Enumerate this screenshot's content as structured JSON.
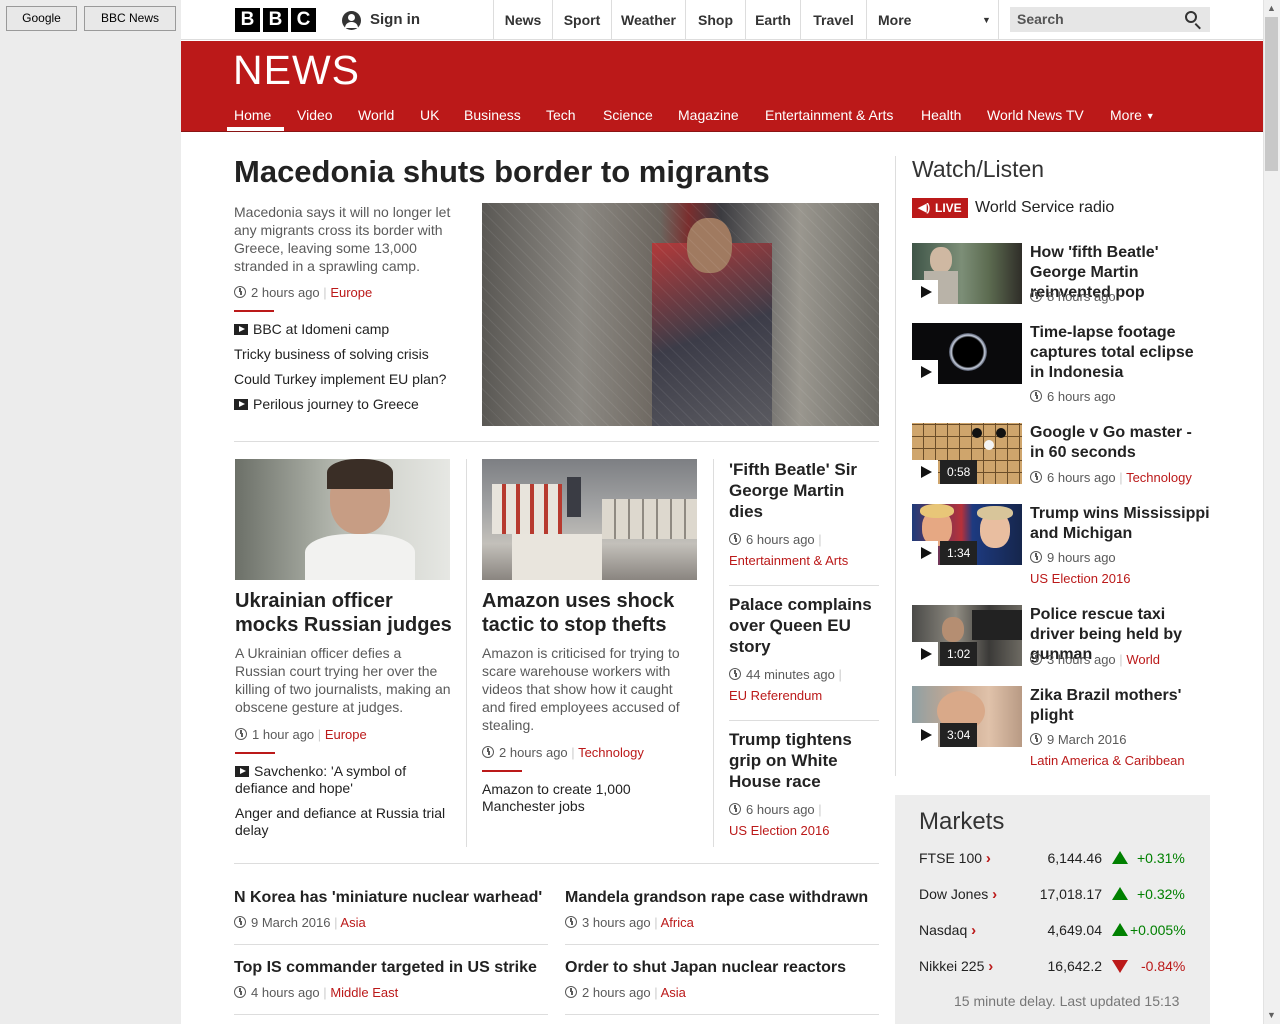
{
  "bookmarks": [
    "Google",
    "BBC News"
  ],
  "topbar": {
    "logo_letters": [
      "B",
      "B",
      "C"
    ],
    "signin": "Sign in",
    "nav": [
      "News",
      "Sport",
      "Weather",
      "Shop",
      "Earth",
      "Travel",
      "More"
    ],
    "search_placeholder": "Search"
  },
  "header": {
    "logo": "NEWS"
  },
  "subnav": [
    "Home",
    "Video",
    "World",
    "UK",
    "Business",
    "Tech",
    "Science",
    "Magazine",
    "Entertainment & Arts",
    "Health",
    "World News TV",
    "More"
  ],
  "lead": {
    "headline": "Macedonia shuts border to migrants",
    "summary": "Macedonia says it will no longer let any migrants cross its border with Greece, leaving some 13,000 stranded in a sprawling camp.",
    "time": "2 hours ago",
    "tag": "Europe",
    "related": [
      "BBC at Idomeni camp",
      "Tricky business of solving crisis",
      "Could Turkey implement EU plan?",
      "Perilous journey to Greece"
    ]
  },
  "story2": {
    "headline": "Ukrainian officer mocks Russian judges",
    "summary": "A Ukrainian officer defies a Russian court trying her over the killing of two journalists, making an obscene gesture at judges.",
    "time": "1 hour ago",
    "tag": "Europe",
    "related": [
      "Savchenko: 'A symbol of defiance and hope'",
      "Anger and defiance at Russia trial delay"
    ]
  },
  "story3": {
    "headline": "Amazon uses shock tactic to stop thefts",
    "summary": "Amazon is criticised for trying to scare warehouse workers with videos that show how it caught and fired employees accused of stealing.",
    "time": "2 hours ago",
    "tag": "Technology",
    "related": [
      "Amazon to create 1,000 Manchester jobs"
    ]
  },
  "col3": [
    {
      "headline": "'Fifth Beatle' Sir George Martin dies",
      "time": "6 hours ago",
      "tag": "Entertainment & Arts"
    },
    {
      "headline": "Palace complains over Queen EU story",
      "time": "44 minutes ago",
      "tag": "EU Referendum"
    },
    {
      "headline": "Trump tightens grip on White House race",
      "time": "6 hours ago",
      "tag": "US Election 2016"
    }
  ],
  "bottom": [
    {
      "headline": "N Korea has 'miniature nuclear warhead'",
      "time": "9 March 2016",
      "tag": "Asia"
    },
    {
      "headline": "Mandela grandson rape case withdrawn",
      "time": "3 hours ago",
      "tag": "Africa"
    },
    {
      "headline": "Top IS commander targeted in US strike",
      "time": "4 hours ago",
      "tag": "Middle East"
    },
    {
      "headline": "Order to shut Japan nuclear reactors",
      "time": "2 hours ago",
      "tag": "Asia"
    }
  ],
  "watch": {
    "title": "Watch/Listen",
    "live_badge": "LIVE",
    "live_label": "World Service radio",
    "items": [
      {
        "headline": "How 'fifth Beatle' George Martin reinvented pop",
        "time": "8 hours ago",
        "duration": "",
        "tag": ""
      },
      {
        "headline": "Time-lapse footage captures total eclipse in Indonesia",
        "time": "6 hours ago",
        "duration": "",
        "tag": ""
      },
      {
        "headline": "Google v Go master - in 60 seconds",
        "time": "6 hours ago",
        "duration": "0:58",
        "tag": "Technology"
      },
      {
        "headline": "Trump wins Mississippi and Michigan",
        "time": "9 hours ago",
        "duration": "1:34",
        "tag": "US Election 2016"
      },
      {
        "headline": "Police rescue taxi driver being held by gunman",
        "time": "3 hours ago",
        "duration": "1:02",
        "tag": "World"
      },
      {
        "headline": "Zika Brazil mothers' plight",
        "time": "9 March 2016",
        "duration": "3:04",
        "tag": "Latin America & Caribbean"
      }
    ]
  },
  "markets": {
    "title": "Markets",
    "rows": [
      {
        "name": "FTSE 100",
        "value": "6,144.46",
        "change": "+0.31%",
        "direction": "up"
      },
      {
        "name": "Dow Jones",
        "value": "17,018.17",
        "change": "+0.32%",
        "direction": "up"
      },
      {
        "name": "Nasdaq",
        "value": "4,649.04",
        "change": "+0.005%",
        "direction": "up"
      },
      {
        "name": "Nikkei 225",
        "value": "16,642.2",
        "change": "-0.84%",
        "direction": "down"
      }
    ],
    "footer": "15 minute delay. Last updated 15:13"
  },
  "colors": {
    "brand_red": "#bb1919",
    "up_green": "#008000"
  }
}
